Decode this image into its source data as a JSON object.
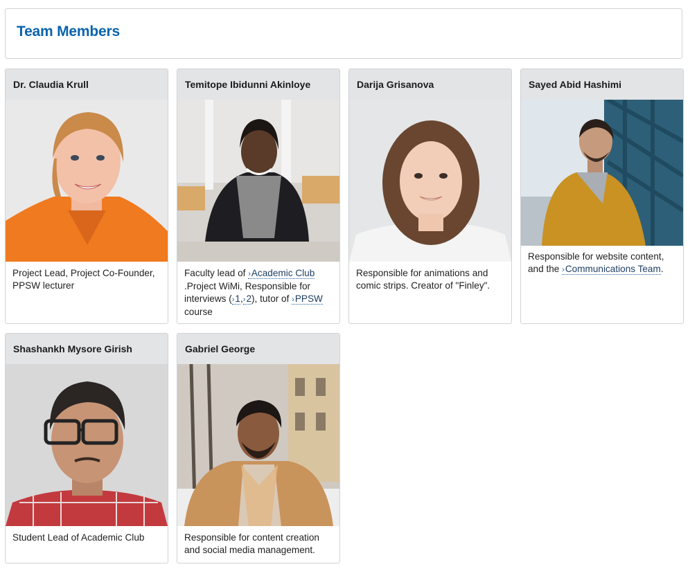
{
  "page": {
    "title": "Team Members"
  },
  "members": [
    {
      "name": "Dr. Claudia Krull",
      "description": "Project Lead, Project Co-Founder, PPSW lecturer"
    },
    {
      "name": "Temitope Ibidunni Akinloye",
      "desc_parts": {
        "p1": "Faculty lead of ",
        "link1": "Academic Club",
        "p2": " .Project WiMi, Responsible for interviews (",
        "link2": "1",
        "p3": ",",
        "link3": "2",
        "p4": "), tutor of ",
        "link4": "PPSW",
        "p5": " course"
      }
    },
    {
      "name": "Darija Grisanova",
      "description": "Responsible for animations and comic strips. Creator of \"Finley\"."
    },
    {
      "name": "Sayed Abid Hashimi",
      "desc_parts": {
        "p1": "Responsible for website content, and the ",
        "link1": "Communications Team",
        "p2": "."
      }
    },
    {
      "name": "Shashankh Mysore Girish",
      "description": "Student Lead of Academic Club"
    },
    {
      "name": "Gabriel George",
      "description": "Responsible for content creation and social media management."
    }
  ],
  "link_chevron": "›"
}
